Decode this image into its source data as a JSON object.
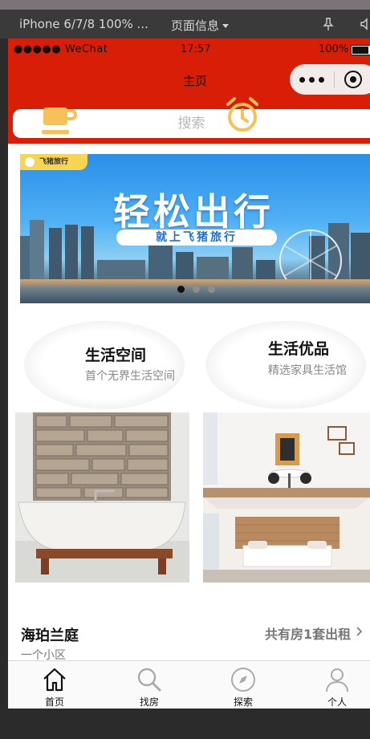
{
  "devtools": {
    "device_label": "iPhone 6/7/8 100% ...",
    "page_info_label": "页面信息",
    "pin_icon": "pin-icon",
    "speaker_icon": "speaker-icon"
  },
  "status_bar": {
    "carrier": "●●●●● WeChat",
    "time": "17:57",
    "battery": "100%"
  },
  "nav": {
    "title": "主页",
    "more_icon": "more-dots-icon",
    "close_icon": "target-icon"
  },
  "search": {
    "placeholder": "搜索"
  },
  "banner": {
    "logo_text": "飞猪旅行",
    "title": "轻松出行",
    "subtitle": "就上飞猪旅行",
    "slide_count": 3,
    "active_slide": 1
  },
  "categories": [
    {
      "title": "生活空间",
      "subtitle": "首个无界生活空间",
      "icon": "coffee-cup-icon"
    },
    {
      "title": "生活优品",
      "subtitle": "精选家具生活馆",
      "icon": "alarm-clock-icon"
    }
  ],
  "photos": [
    {
      "name": "bathtub-photo"
    },
    {
      "name": "dining-room-photo"
    },
    {
      "name": "bedroom-photo"
    }
  ],
  "listing": {
    "name": "海珀兰庭",
    "count_text": "共有房1套出租",
    "subtitle": "一个小区"
  },
  "tabbar": [
    {
      "label": "首页",
      "icon": "home-icon",
      "active": true
    },
    {
      "label": "找房",
      "icon": "search-icon",
      "active": false
    },
    {
      "label": "探索",
      "icon": "compass-icon",
      "active": false
    },
    {
      "label": "个人",
      "icon": "person-icon",
      "active": false
    }
  ],
  "colors": {
    "header_red": "#d81e06",
    "accent_yellow": "#f7c15a",
    "tab_active": "#111111"
  }
}
